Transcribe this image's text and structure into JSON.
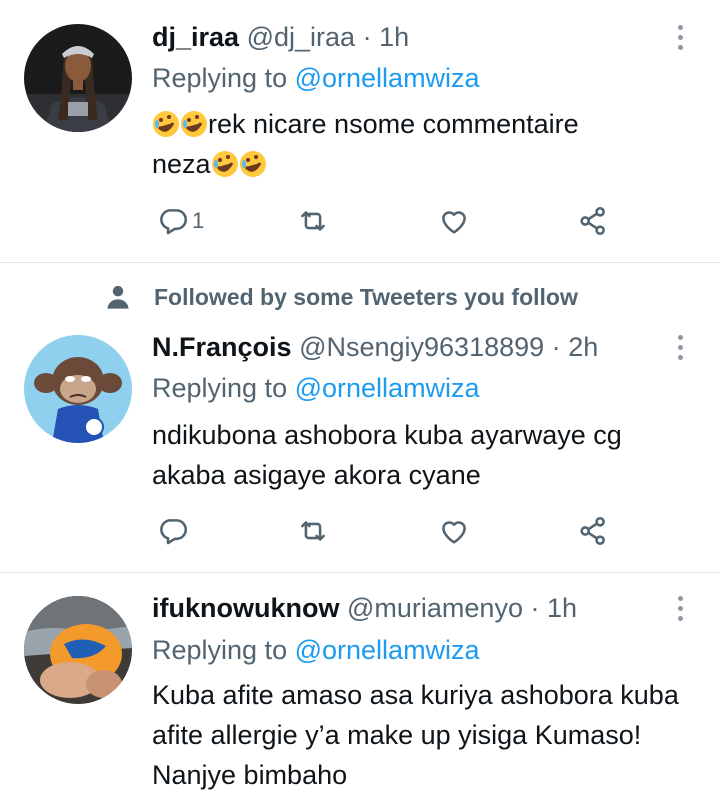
{
  "tweets": [
    {
      "display_name": "dj_iraa",
      "handle": "@dj_iraa",
      "separator": "·",
      "time": "1h",
      "reply_prefix": "Replying to",
      "reply_to": "@ornellamwiza",
      "text_line1_emoji": "🤣🤣",
      "text_line1": "rek nicare nsome commentaire",
      "text_line2": "neza",
      "text_line2_emoji": "🤣🤣",
      "reply_count": "1"
    },
    {
      "social_context": "Followed by some Tweeters you follow",
      "display_name": "N.François",
      "handle": "@Nsengiy96318899",
      "separator": "·",
      "time": "2h",
      "reply_prefix": "Replying to",
      "reply_to": "@ornellamwiza",
      "text": "ndikubona ashobora kuba ayarwaye cg akaba asigaye akora cyane"
    },
    {
      "display_name": "ifuknowuknow",
      "handle": "@muriamenyo",
      "separator": "·",
      "time": "1h",
      "reply_prefix": "Replying to",
      "reply_to": "@ornellamwiza",
      "text": "Kuba afite amaso asa kuriya ashobora kuba afite allergie y’a make up yisiga Kumaso! Nanjye bimbaho"
    }
  ],
  "colors": {
    "text": "#0f1419",
    "secondary": "#536471",
    "accent": "#1d9bf0",
    "divider": "#e3e7ea"
  },
  "icons": [
    "reply-icon",
    "retweet-icon",
    "like-icon",
    "share-icon",
    "more-icon",
    "person-icon"
  ]
}
